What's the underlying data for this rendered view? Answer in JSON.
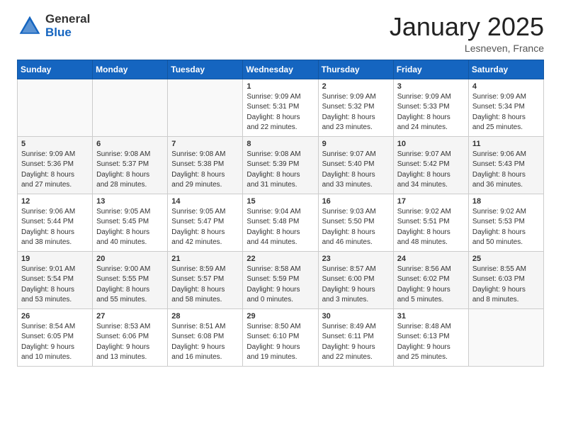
{
  "header": {
    "logo_general": "General",
    "logo_blue": "Blue",
    "month": "January 2025",
    "location": "Lesneven, France"
  },
  "days_of_week": [
    "Sunday",
    "Monday",
    "Tuesday",
    "Wednesday",
    "Thursday",
    "Friday",
    "Saturday"
  ],
  "weeks": [
    [
      {
        "day": "",
        "info": ""
      },
      {
        "day": "",
        "info": ""
      },
      {
        "day": "",
        "info": ""
      },
      {
        "day": "1",
        "info": "Sunrise: 9:09 AM\nSunset: 5:31 PM\nDaylight: 8 hours\nand 22 minutes."
      },
      {
        "day": "2",
        "info": "Sunrise: 9:09 AM\nSunset: 5:32 PM\nDaylight: 8 hours\nand 23 minutes."
      },
      {
        "day": "3",
        "info": "Sunrise: 9:09 AM\nSunset: 5:33 PM\nDaylight: 8 hours\nand 24 minutes."
      },
      {
        "day": "4",
        "info": "Sunrise: 9:09 AM\nSunset: 5:34 PM\nDaylight: 8 hours\nand 25 minutes."
      }
    ],
    [
      {
        "day": "5",
        "info": "Sunrise: 9:09 AM\nSunset: 5:36 PM\nDaylight: 8 hours\nand 27 minutes."
      },
      {
        "day": "6",
        "info": "Sunrise: 9:08 AM\nSunset: 5:37 PM\nDaylight: 8 hours\nand 28 minutes."
      },
      {
        "day": "7",
        "info": "Sunrise: 9:08 AM\nSunset: 5:38 PM\nDaylight: 8 hours\nand 29 minutes."
      },
      {
        "day": "8",
        "info": "Sunrise: 9:08 AM\nSunset: 5:39 PM\nDaylight: 8 hours\nand 31 minutes."
      },
      {
        "day": "9",
        "info": "Sunrise: 9:07 AM\nSunset: 5:40 PM\nDaylight: 8 hours\nand 33 minutes."
      },
      {
        "day": "10",
        "info": "Sunrise: 9:07 AM\nSunset: 5:42 PM\nDaylight: 8 hours\nand 34 minutes."
      },
      {
        "day": "11",
        "info": "Sunrise: 9:06 AM\nSunset: 5:43 PM\nDaylight: 8 hours\nand 36 minutes."
      }
    ],
    [
      {
        "day": "12",
        "info": "Sunrise: 9:06 AM\nSunset: 5:44 PM\nDaylight: 8 hours\nand 38 minutes."
      },
      {
        "day": "13",
        "info": "Sunrise: 9:05 AM\nSunset: 5:45 PM\nDaylight: 8 hours\nand 40 minutes."
      },
      {
        "day": "14",
        "info": "Sunrise: 9:05 AM\nSunset: 5:47 PM\nDaylight: 8 hours\nand 42 minutes."
      },
      {
        "day": "15",
        "info": "Sunrise: 9:04 AM\nSunset: 5:48 PM\nDaylight: 8 hours\nand 44 minutes."
      },
      {
        "day": "16",
        "info": "Sunrise: 9:03 AM\nSunset: 5:50 PM\nDaylight: 8 hours\nand 46 minutes."
      },
      {
        "day": "17",
        "info": "Sunrise: 9:02 AM\nSunset: 5:51 PM\nDaylight: 8 hours\nand 48 minutes."
      },
      {
        "day": "18",
        "info": "Sunrise: 9:02 AM\nSunset: 5:53 PM\nDaylight: 8 hours\nand 50 minutes."
      }
    ],
    [
      {
        "day": "19",
        "info": "Sunrise: 9:01 AM\nSunset: 5:54 PM\nDaylight: 8 hours\nand 53 minutes."
      },
      {
        "day": "20",
        "info": "Sunrise: 9:00 AM\nSunset: 5:55 PM\nDaylight: 8 hours\nand 55 minutes."
      },
      {
        "day": "21",
        "info": "Sunrise: 8:59 AM\nSunset: 5:57 PM\nDaylight: 8 hours\nand 58 minutes."
      },
      {
        "day": "22",
        "info": "Sunrise: 8:58 AM\nSunset: 5:59 PM\nDaylight: 9 hours\nand 0 minutes."
      },
      {
        "day": "23",
        "info": "Sunrise: 8:57 AM\nSunset: 6:00 PM\nDaylight: 9 hours\nand 3 minutes."
      },
      {
        "day": "24",
        "info": "Sunrise: 8:56 AM\nSunset: 6:02 PM\nDaylight: 9 hours\nand 5 minutes."
      },
      {
        "day": "25",
        "info": "Sunrise: 8:55 AM\nSunset: 6:03 PM\nDaylight: 9 hours\nand 8 minutes."
      }
    ],
    [
      {
        "day": "26",
        "info": "Sunrise: 8:54 AM\nSunset: 6:05 PM\nDaylight: 9 hours\nand 10 minutes."
      },
      {
        "day": "27",
        "info": "Sunrise: 8:53 AM\nSunset: 6:06 PM\nDaylight: 9 hours\nand 13 minutes."
      },
      {
        "day": "28",
        "info": "Sunrise: 8:51 AM\nSunset: 6:08 PM\nDaylight: 9 hours\nand 16 minutes."
      },
      {
        "day": "29",
        "info": "Sunrise: 8:50 AM\nSunset: 6:10 PM\nDaylight: 9 hours\nand 19 minutes."
      },
      {
        "day": "30",
        "info": "Sunrise: 8:49 AM\nSunset: 6:11 PM\nDaylight: 9 hours\nand 22 minutes."
      },
      {
        "day": "31",
        "info": "Sunrise: 8:48 AM\nSunset: 6:13 PM\nDaylight: 9 hours\nand 25 minutes."
      },
      {
        "day": "",
        "info": ""
      }
    ]
  ]
}
